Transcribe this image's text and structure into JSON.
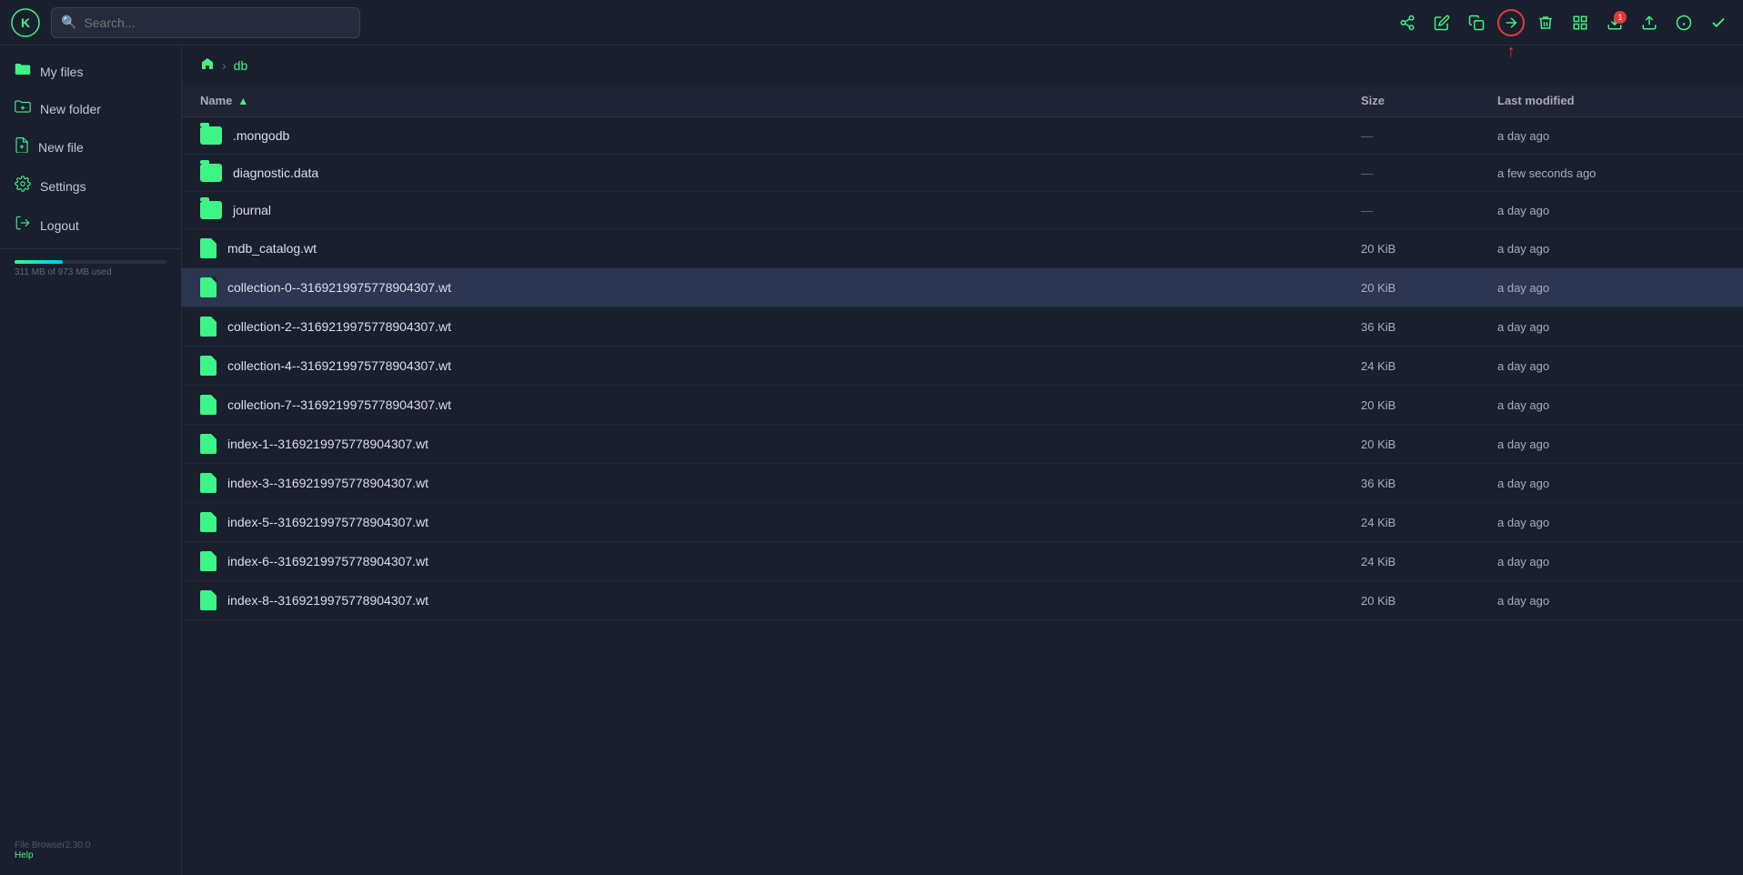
{
  "app": {
    "logo_text": "K",
    "search_placeholder": "Search..."
  },
  "topbar": {
    "icons": [
      {
        "name": "share-icon",
        "symbol": "⬆",
        "label": "Share"
      },
      {
        "name": "edit-icon",
        "symbol": "✏",
        "label": "Edit"
      },
      {
        "name": "copy-icon",
        "symbol": "⧉",
        "label": "Copy"
      },
      {
        "name": "move-icon",
        "symbol": "➜",
        "label": "Move",
        "active": true
      },
      {
        "name": "delete-icon",
        "symbol": "🗑",
        "label": "Delete"
      },
      {
        "name": "grid-icon",
        "symbol": "⊞",
        "label": "Grid view"
      },
      {
        "name": "download-icon",
        "symbol": "⬇",
        "label": "Download",
        "badge": "1"
      },
      {
        "name": "upload-icon",
        "symbol": "⬆",
        "label": "Upload"
      },
      {
        "name": "info-icon",
        "symbol": "ℹ",
        "label": "Info"
      },
      {
        "name": "check-icon",
        "symbol": "✓",
        "label": "Check"
      }
    ]
  },
  "sidebar": {
    "items": [
      {
        "id": "my-files",
        "label": "My files",
        "icon": "folder"
      },
      {
        "id": "new-folder",
        "label": "New folder",
        "icon": "plus-folder"
      },
      {
        "id": "new-file",
        "label": "New file",
        "icon": "plus-file"
      },
      {
        "id": "settings",
        "label": "Settings",
        "icon": "gear"
      },
      {
        "id": "logout",
        "label": "Logout",
        "icon": "logout"
      }
    ],
    "storage": {
      "used": "311 MB of 973 MB used",
      "percent": 32
    },
    "footer": {
      "version": "File Browser2.30.0",
      "help": "Help"
    }
  },
  "breadcrumb": {
    "home_icon": "🏠",
    "separator": "›",
    "path": "db"
  },
  "table": {
    "columns": {
      "name": "Name",
      "size": "Size",
      "last_modified": "Last modified"
    },
    "files": [
      {
        "type": "folder",
        "name": ".mongodb",
        "size": "—",
        "modified": "a day ago",
        "selected": false
      },
      {
        "type": "folder",
        "name": "diagnostic.data",
        "size": "—",
        "modified": "a few seconds ago",
        "selected": false
      },
      {
        "type": "folder",
        "name": "journal",
        "size": "—",
        "modified": "a day ago",
        "selected": false
      },
      {
        "type": "file",
        "name": "mdb_catalog.wt",
        "size": "20 KiB",
        "modified": "a day ago",
        "selected": false
      },
      {
        "type": "file",
        "name": "collection-0--3169219975778904307.wt",
        "size": "20 KiB",
        "modified": "a day ago",
        "selected": true
      },
      {
        "type": "file",
        "name": "collection-2--3169219975778904307.wt",
        "size": "36 KiB",
        "modified": "a day ago",
        "selected": false
      },
      {
        "type": "file",
        "name": "collection-4--3169219975778904307.wt",
        "size": "24 KiB",
        "modified": "a day ago",
        "selected": false
      },
      {
        "type": "file",
        "name": "collection-7--3169219975778904307.wt",
        "size": "20 KiB",
        "modified": "a day ago",
        "selected": false
      },
      {
        "type": "file",
        "name": "index-1--3169219975778904307.wt",
        "size": "20 KiB",
        "modified": "a day ago",
        "selected": false
      },
      {
        "type": "file",
        "name": "index-3--3169219975778904307.wt",
        "size": "36 KiB",
        "modified": "a day ago",
        "selected": false
      },
      {
        "type": "file",
        "name": "index-5--3169219975778904307.wt",
        "size": "24 KiB",
        "modified": "a day ago",
        "selected": false
      },
      {
        "type": "file",
        "name": "index-6--3169219975778904307.wt",
        "size": "24 KiB",
        "modified": "a day ago",
        "selected": false
      },
      {
        "type": "file",
        "name": "index-8--3169219975778904307.wt",
        "size": "20 KiB",
        "modified": "a day ago",
        "selected": false
      }
    ]
  }
}
